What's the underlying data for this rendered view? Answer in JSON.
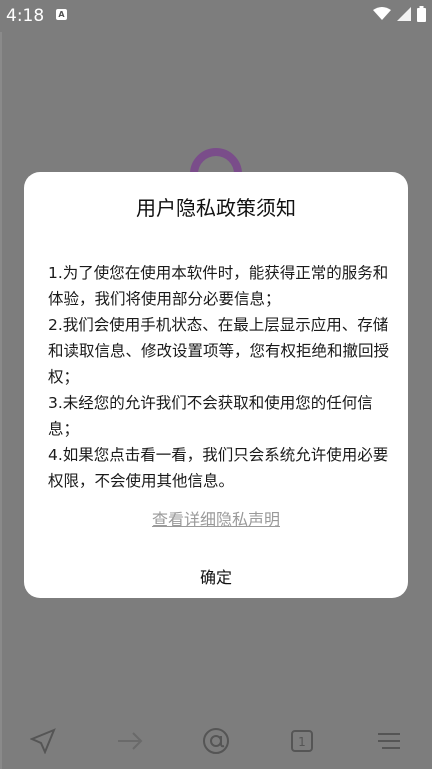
{
  "status_bar": {
    "time": "4:18",
    "icons": [
      "app-notification-icon",
      "wifi-icon",
      "cellular-signal-icon",
      "battery-icon"
    ]
  },
  "dialog": {
    "title": "用户隐私政策须知",
    "paragraphs": [
      "1.为了使您在使用本软件时，能获得正常的服务和体验，我们将使用部分必要信息；",
      "2.我们会使用手机状态、在最上层显示应用、存储和读取信息、修改设置项等，您有权拒绝和撤回授权；",
      "3.未经您的允许我们不会获取和使用您的任何信息；",
      "4.如果您点击看一看，我们只会系统允许使用必要权限，不会使用其他信息。"
    ],
    "detail_link": "查看详细隐私声明",
    "confirm_label": "确定"
  },
  "bottom_nav": {
    "items": [
      "send-icon",
      "forward-arrow-icon",
      "at-sign-icon",
      "tab-count-icon",
      "menu-icon"
    ],
    "tab_count": "1"
  },
  "colors": {
    "overlay": "#7d7d7d",
    "dialog_bg": "#ffffff",
    "link": "#9a9a9a",
    "logo": "#7a4d8a"
  }
}
